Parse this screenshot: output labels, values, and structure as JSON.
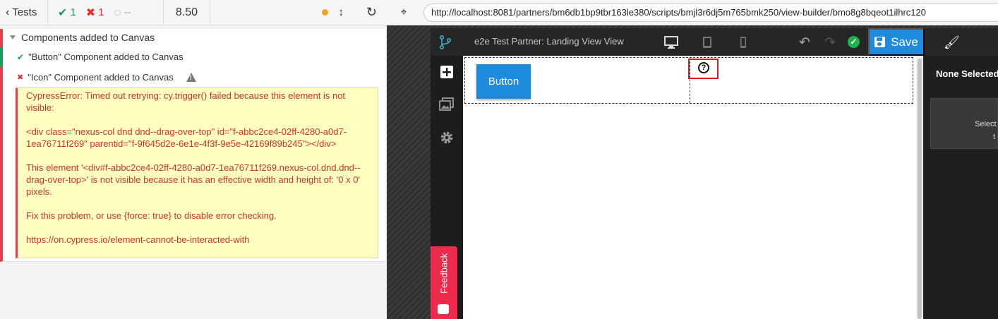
{
  "reporter": {
    "tests_label": "Tests",
    "passed": "1",
    "failed": "1",
    "pending": "--",
    "duration": "8.50",
    "suite_title": "Components added to Canvas",
    "tests": [
      {
        "title": "\"Button\" Component added to Canvas",
        "state": "passed"
      },
      {
        "title": "\"Icon\" Component added to Canvas",
        "state": "failed"
      }
    ],
    "error": {
      "line1": "CypressError: Timed out retrying: cy.trigger() failed because this element is not visible:",
      "line2": "<div class=\"nexus-col dnd dnd--drag-over-top\" id=\"f-abbc2ce4-02ff-4280-a0d7-1ea76711f269\" parentid=\"f-9f645d2e-6e1e-4f3f-9e5e-42169f89b245\"></div>",
      "line3": "This element '<div#f-abbc2ce4-02ff-4280-a0d7-1ea76711f269.nexus-col.dnd.dnd--drag-over-top>' is not visible because it has an effective width and height of: '0 x 0' pixels.",
      "line4": "Fix this problem, or use {force: true} to disable error checking.",
      "line5": "https://on.cypress.io/element-cannot-be-interacted-with"
    }
  },
  "aut": {
    "url": "http://localhost:8081/partners/bm6db1bp9tbr163le380/scripts/bmjl3r6dj5m765bmk250/view-builder/bmo8g8bqeot1ilhrc120",
    "app_title": "e2e Test Partner: Landing View View",
    "save_label": "Save",
    "feedback_label": "Feedback",
    "canvas_button_label": "Button",
    "panel_title": "None Selected",
    "panel_hint_1": "Select",
    "panel_hint_2": "t"
  },
  "colors": {
    "pass": "#1d9b5c",
    "fail": "#e3302f",
    "accent": "#1e8bdc",
    "feedback": "#ee2b4d",
    "error_bg": "#ffffc2"
  }
}
